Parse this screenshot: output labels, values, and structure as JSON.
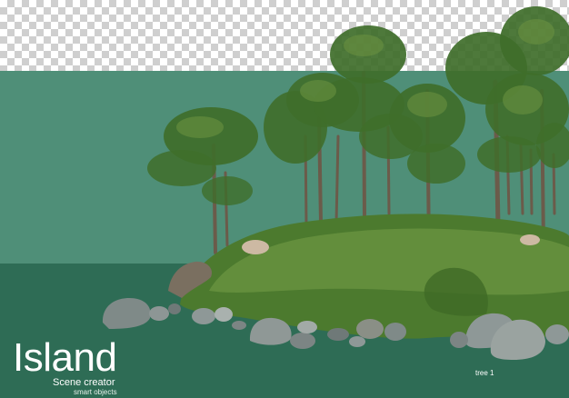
{
  "title": "Island",
  "subtitle": "Scene creator",
  "caption": "smart objects",
  "item_label": "tree 1",
  "colors": {
    "backdrop": "#4f8f78",
    "floor": "#2e6c55",
    "foliage": "#3f6e2a",
    "grass": "#5e8a3a",
    "rock": "#7f8a8a",
    "text": "#ffffff"
  }
}
